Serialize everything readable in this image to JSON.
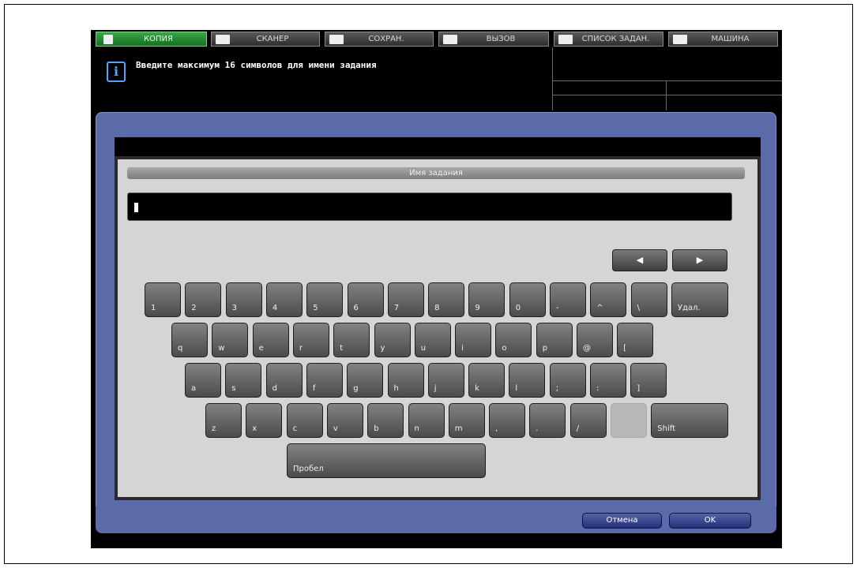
{
  "tabs": [
    {
      "label": "КОПИЯ",
      "icon": "copy-icon",
      "active": true
    },
    {
      "label": "СКАНЕР",
      "icon": "scanner-icon",
      "active": false
    },
    {
      "label": "СОХРАН.",
      "icon": "save-icon",
      "active": false
    },
    {
      "label": "ВЫЗОВ",
      "icon": "recall-icon",
      "active": false
    },
    {
      "label": "СПИСОК ЗАДАН.",
      "icon": "job-list-icon",
      "active": false
    },
    {
      "label": "МАШИНА",
      "icon": "machine-icon",
      "active": false
    }
  ],
  "message": {
    "icon": "info-icon",
    "icon_glyph": "i",
    "text": "Введите максимум 16 символов для имени задания"
  },
  "dialog": {
    "title": "Имя задания",
    "input_value": "",
    "arrow_left": "◀",
    "arrow_right": "▶"
  },
  "keyboard": {
    "row1": [
      "1",
      "2",
      "3",
      "4",
      "5",
      "6",
      "7",
      "8",
      "9",
      "0",
      "-",
      "^",
      "\\"
    ],
    "delete_label": "Удал.",
    "row2": [
      "q",
      "w",
      "e",
      "r",
      "t",
      "y",
      "u",
      "i",
      "o",
      "p",
      "@",
      "["
    ],
    "row3": [
      "a",
      "s",
      "d",
      "f",
      "g",
      "h",
      "j",
      "k",
      "l",
      ";",
      ":",
      "]"
    ],
    "row4": [
      "z",
      "x",
      "c",
      "v",
      "b",
      "n",
      "m",
      ",",
      ".",
      "/"
    ],
    "shift_label": "Shift",
    "space_label": "Пробел"
  },
  "footer": {
    "cancel_label": "Отмена",
    "ok_label": "OK"
  },
  "colors": {
    "accent_tab": "#2e9a3c",
    "dialog_frame": "#5b6aa8",
    "info": "#4ea6ff"
  }
}
